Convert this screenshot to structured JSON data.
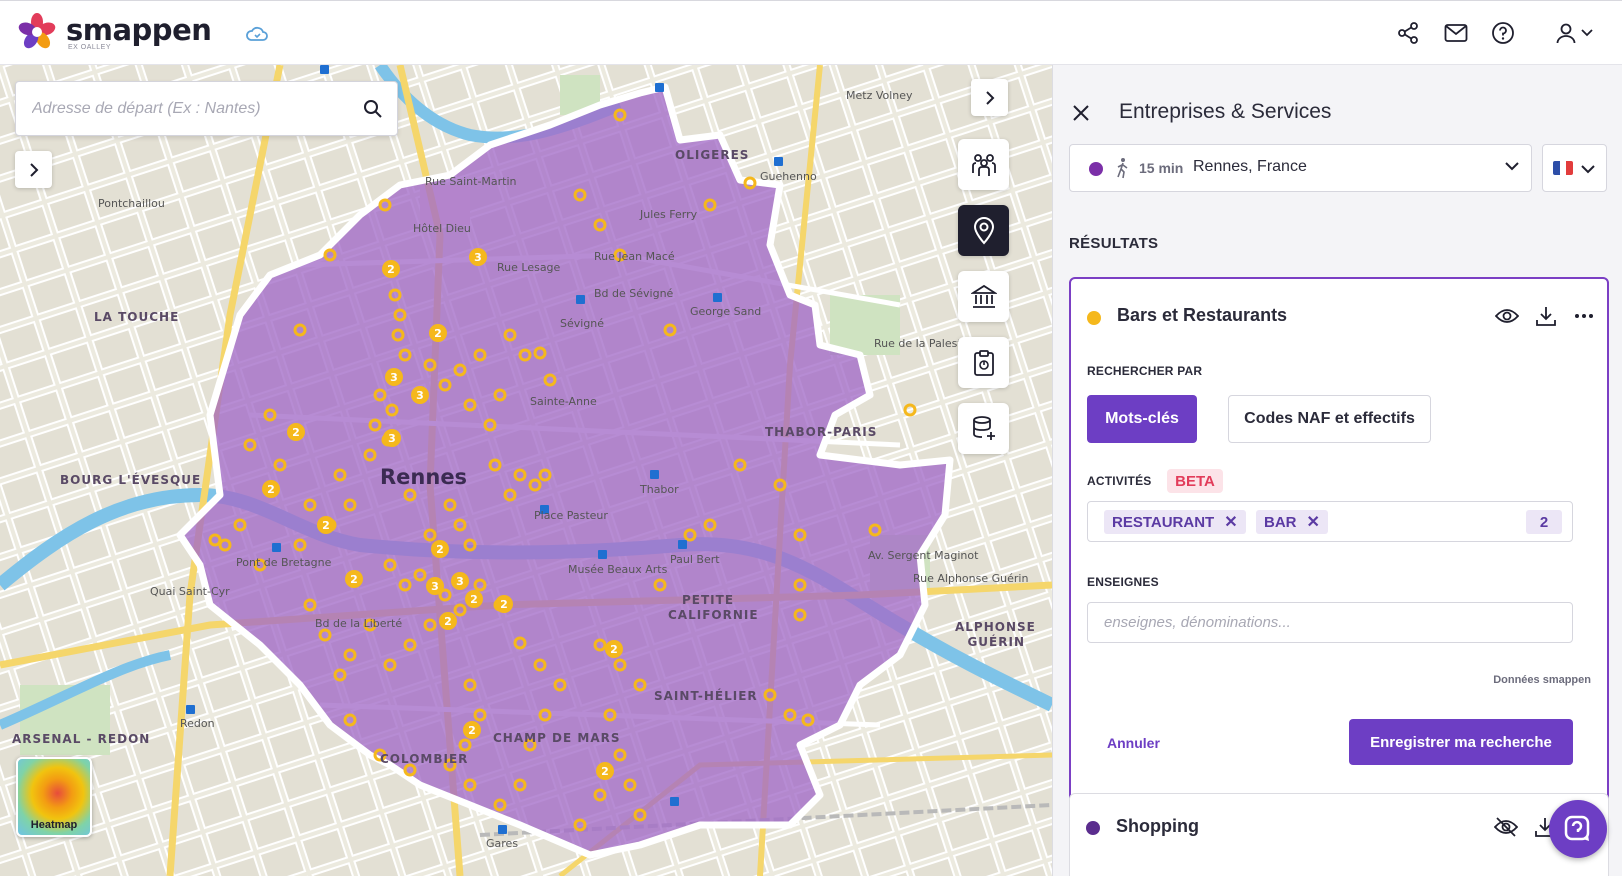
{
  "header": {
    "brand": "smappen",
    "brand_sub": "EX OALLEY"
  },
  "search": {
    "placeholder": "Adresse de départ (Ex : Nantes)"
  },
  "map": {
    "heatmap_label": "Heatmap",
    "labels": [
      {
        "text": "Rennes",
        "kind": "big"
      },
      {
        "text": "LA TOUCHE",
        "kind": "dist"
      },
      {
        "text": "BOURG L'ÉVESQUE",
        "kind": "dist"
      },
      {
        "text": "OLIGERES",
        "kind": "dist"
      },
      {
        "text": "THABOR-PARIS",
        "kind": "dist"
      },
      {
        "text": "PETITE CALIFORNIE",
        "kind": "dist"
      },
      {
        "text": "SAINT-HÉLIER",
        "kind": "dist"
      },
      {
        "text": "ARSENAL - REDON",
        "kind": "dist"
      },
      {
        "text": "ALPHONSE GUÉRIN",
        "kind": "dist"
      },
      {
        "text": "CHAMP DE MARS",
        "kind": "dist"
      },
      {
        "text": "COLOMBIER",
        "kind": "dist"
      },
      {
        "text": "Hôtel Dieu",
        "kind": "place"
      },
      {
        "text": "Rue Jean Macé",
        "kind": "street"
      },
      {
        "text": "Bd de Sévigné",
        "kind": "street"
      },
      {
        "text": "George Sand",
        "kind": "street"
      },
      {
        "text": "Rue Lesage",
        "kind": "street"
      },
      {
        "text": "Rue de la Palestine",
        "kind": "street"
      },
      {
        "text": "Av. Sergent Maginot",
        "kind": "street"
      },
      {
        "text": "Rue Alphonse Guérin",
        "kind": "street"
      },
      {
        "text": "Quai Saint-Cyr",
        "kind": "street"
      },
      {
        "text": "Pont de Bretagne",
        "kind": "street"
      },
      {
        "text": "Bd de la Liberté",
        "kind": "street"
      },
      {
        "text": "Rue Saint-Martin",
        "kind": "street"
      },
      {
        "text": "Pontchaillou",
        "kind": "place"
      },
      {
        "text": "Jules Ferry",
        "kind": "place"
      },
      {
        "text": "Metz Volney",
        "kind": "place"
      },
      {
        "text": "Gares",
        "kind": "place"
      },
      {
        "text": "Redon",
        "kind": "place"
      },
      {
        "text": "Thabor",
        "kind": "place"
      },
      {
        "text": "Sévigné",
        "kind": "place"
      },
      {
        "text": "Guehenno",
        "kind": "place"
      },
      {
        "text": "Place Pasteur",
        "kind": "place"
      },
      {
        "text": "Paul Bert",
        "kind": "place"
      },
      {
        "text": "Musée Beaux Arts",
        "kind": "place"
      },
      {
        "text": "Sainte-Anne",
        "kind": "place"
      }
    ]
  },
  "panel": {
    "title": "Entreprises & Services",
    "zone": {
      "time": "15 min",
      "city": "Rennes, France"
    },
    "results_title": "RÉSULTATS",
    "card": {
      "title": "Bars et Restaurants",
      "search_by_label": "RECHERCHER PAR",
      "mode_keywords": "Mots-clés",
      "mode_naf": "Codes NAF et effectifs",
      "activities_label": "ACTIVITÉS",
      "beta": "BETA",
      "tags": [
        "RESTAURANT",
        "BAR"
      ],
      "tag_count": "2",
      "brands_label": "ENSEIGNES",
      "brands_placeholder": "enseignes, dénominations...",
      "data_source": "Données smappen",
      "cancel": "Annuler",
      "save": "Enregistrer ma recherche"
    },
    "card2": {
      "title": "Shopping"
    }
  },
  "colors": {
    "accent": "#6d3ec4",
    "isochrone": "#a36bc8",
    "poi": "#f5b81c",
    "dark": "#1f1f2e"
  }
}
